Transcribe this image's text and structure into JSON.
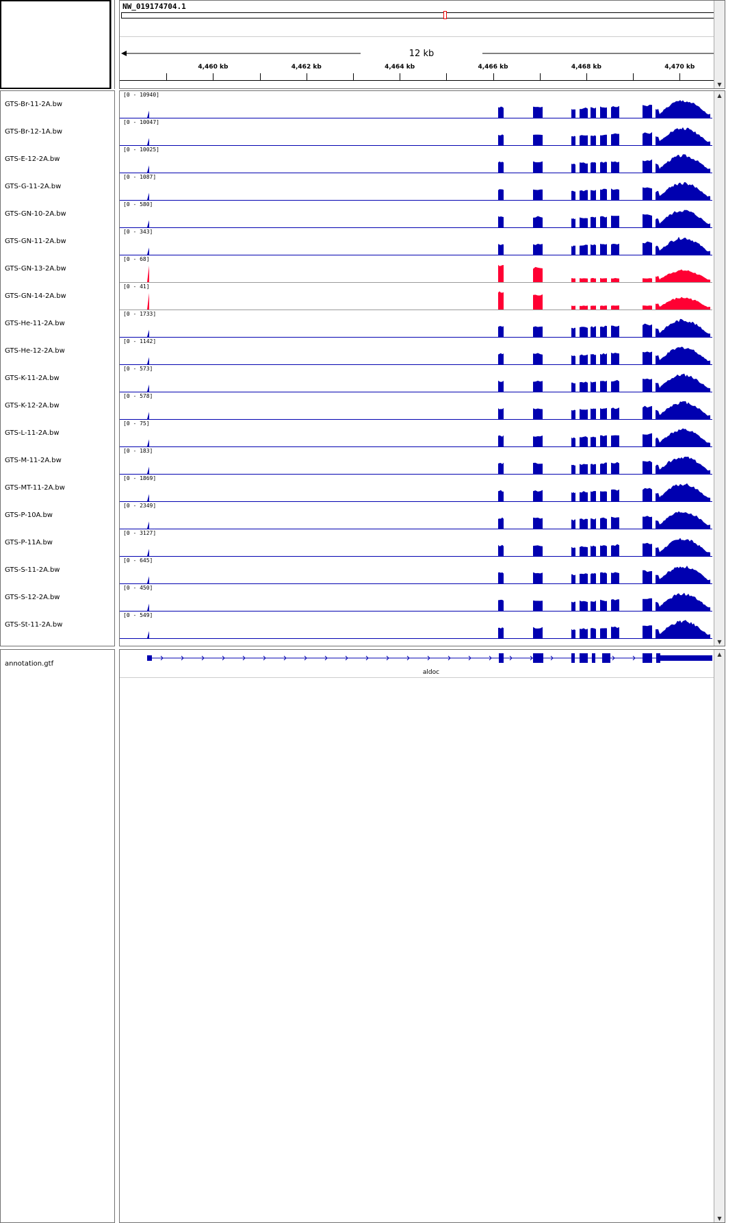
{
  "header": {
    "chromosome": "NW_019174704.1",
    "span_label": "12 kb",
    "ticks": [
      {
        "label": "4,460 kb",
        "kb": 4460
      },
      {
        "label": "4,462 kb",
        "kb": 4462
      },
      {
        "label": "4,464 kb",
        "kb": 4464
      },
      {
        "label": "4,466 kb",
        "kb": 4466
      },
      {
        "label": "4,468 kb",
        "kb": 4468
      },
      {
        "label": "4,470 kb",
        "kb": 4470
      }
    ],
    "view_start_kb": 4458.0,
    "view_end_kb": 4470.7
  },
  "tracks": [
    {
      "name": "GTS-Br-11-2A.bw",
      "range": "[0 - 10940]",
      "color": "#0000b0"
    },
    {
      "name": "GTS-Br-12-1A.bw",
      "range": "[0 - 10047]",
      "color": "#0000b0"
    },
    {
      "name": "GTS-E-12-2A.bw",
      "range": "[0 - 10025]",
      "color": "#0000b0"
    },
    {
      "name": "GTS-G-11-2A.bw",
      "range": "[0 - 1087]",
      "color": "#0000b0"
    },
    {
      "name": "GTS-GN-10-2A.bw",
      "range": "[0 - 580]",
      "color": "#0000b0"
    },
    {
      "name": "GTS-GN-11-2A.bw",
      "range": "[0 - 343]",
      "color": "#0000b0"
    },
    {
      "name": "GTS-GN-13-2A.bw",
      "range": "[0 - 68]",
      "color": "#ff0033"
    },
    {
      "name": "GTS-GN-14-2A.bw",
      "range": "[0 - 41]",
      "color": "#ff0033"
    },
    {
      "name": "GTS-He-11-2A.bw",
      "range": "[0 - 1733]",
      "color": "#0000b0"
    },
    {
      "name": "GTS-He-12-2A.bw",
      "range": "[0 - 1142]",
      "color": "#0000b0"
    },
    {
      "name": "GTS-K-11-2A.bw",
      "range": "[0 - 573]",
      "color": "#0000b0"
    },
    {
      "name": "GTS-K-12-2A.bw",
      "range": "[0 - 578]",
      "color": "#0000b0"
    },
    {
      "name": "GTS-L-11-2A.bw",
      "range": "[0 - 75]",
      "color": "#0000b0"
    },
    {
      "name": "GTS-M-11-2A.bw",
      "range": "[0 - 183]",
      "color": "#0000b0"
    },
    {
      "name": "GTS-MT-11-2A.bw",
      "range": "[0 - 1869]",
      "color": "#0000b0"
    },
    {
      "name": "GTS-P-10A.bw",
      "range": "[0 - 2349]",
      "color": "#0000b0"
    },
    {
      "name": "GTS-P-11A.bw",
      "range": "[0 - 3127]",
      "color": "#0000b0"
    },
    {
      "name": "GTS-S-11-2A.bw",
      "range": "[0 - 645]",
      "color": "#0000b0"
    },
    {
      "name": "GTS-S-12-2A.bw",
      "range": "[0 - 450]",
      "color": "#0000b0"
    },
    {
      "name": "GTS-St-11-2A.bw",
      "range": "[0 - 549]",
      "color": "#0000b0"
    }
  ],
  "annotation": {
    "track_name": "annotation.gtf",
    "gene_name": "aldoc",
    "color": "#0000b0"
  }
}
